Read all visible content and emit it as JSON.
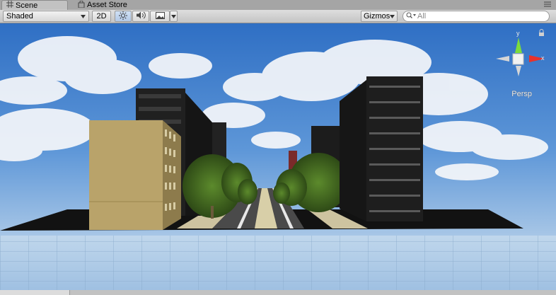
{
  "tabs": [
    {
      "label": "Scene",
      "icon": "grid-icon",
      "active": true
    },
    {
      "label": "Asset Store",
      "icon": "shopping-bag-icon",
      "active": false
    }
  ],
  "toolbar": {
    "shading_mode": "Shaded",
    "toggle_2d_label": "2D",
    "lighting_icon": "sun-icon",
    "audio_icon": "speaker-icon",
    "effects_icon": "image-icon",
    "gizmos_label": "Gizmos",
    "search_placeholder": "All"
  },
  "scene_gizmo": {
    "projection_label": "Persp",
    "axes": [
      "y",
      "x"
    ],
    "colors": {
      "y": "#7ddc3c",
      "x": "#e8322a"
    }
  },
  "colors": {
    "sky": "#3a78c8",
    "ground_grid": "#a9c8e6",
    "selection_blue": "#b3c9e6"
  }
}
